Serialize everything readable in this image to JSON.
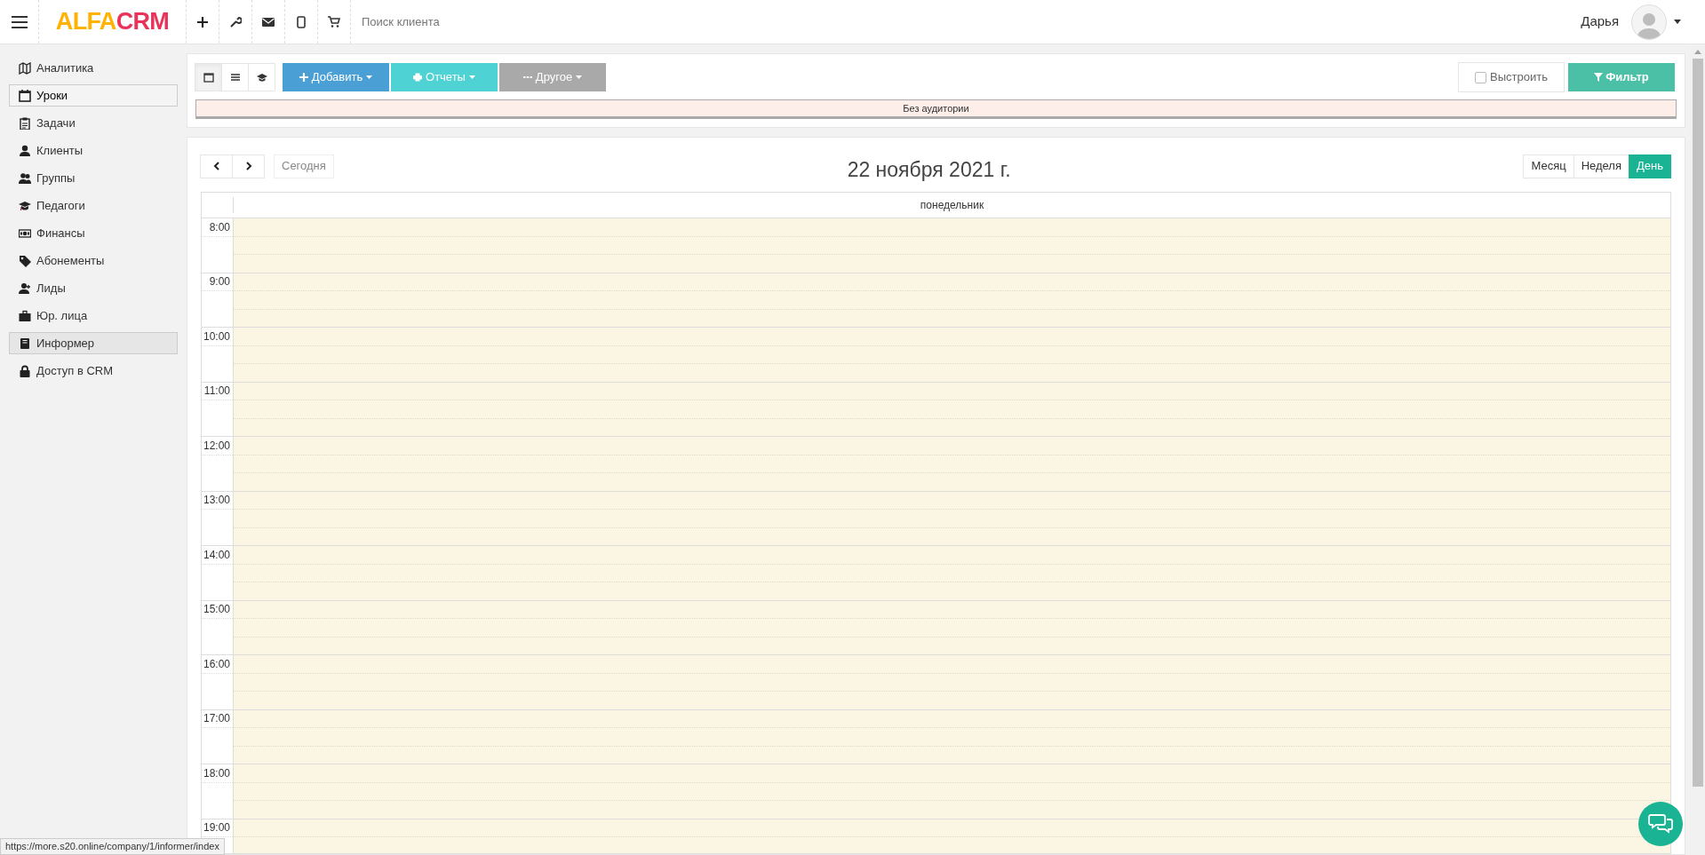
{
  "top_bar": {
    "logo": [
      {
        "text": "ALFA",
        "color": "#ffb300"
      },
      {
        "text": "CRM",
        "color": "#e8335a"
      }
    ],
    "search": {
      "placeholder": "Поиск клиента"
    },
    "user": {
      "name": "Дарья"
    }
  },
  "sidebar": {
    "items": [
      {
        "label": "Аналитика",
        "selected": false,
        "hovered": false
      },
      {
        "label": "Уроки",
        "selected": true,
        "hovered": false
      },
      {
        "label": "Задачи",
        "selected": false,
        "hovered": false
      },
      {
        "label": "Клиенты",
        "selected": false,
        "hovered": false
      },
      {
        "label": "Группы",
        "selected": false,
        "hovered": false
      },
      {
        "label": "Педагоги",
        "selected": false,
        "hovered": false
      },
      {
        "label": "Финансы",
        "selected": false,
        "hovered": false
      },
      {
        "label": "Абонементы",
        "selected": false,
        "hovered": false
      },
      {
        "label": "Лиды",
        "selected": false,
        "hovered": false
      },
      {
        "label": "Юр. лица",
        "selected": false,
        "hovered": false
      },
      {
        "label": "Информер",
        "selected": false,
        "hovered": true
      },
      {
        "label": "Доступ в CRM",
        "selected": false,
        "hovered": false
      }
    ]
  },
  "toolbar": {
    "view_modes": [
      {
        "selected": true
      },
      {
        "selected": false
      },
      {
        "selected": false
      }
    ],
    "buttons": [
      {
        "label": "Добавить"
      },
      {
        "label": "Отчеты"
      },
      {
        "label": "Другое"
      }
    ],
    "arrange": {
      "label": "Выстроить",
      "checked": false
    },
    "filter": {
      "label": "Фильтр"
    },
    "room_bar": "Без аудитории"
  },
  "calendar": {
    "today_button": "Сегодня",
    "title": "22 ноября 2021 г.",
    "views": [
      {
        "label": "Месяц",
        "selected": false
      },
      {
        "label": "Неделя",
        "selected": false
      },
      {
        "label": "День",
        "selected": true
      }
    ],
    "day_header": "понедельник",
    "times": [
      "8:00",
      "9:00",
      "10:00",
      "11:00",
      "12:00",
      "13:00",
      "14:00",
      "15:00",
      "16:00",
      "17:00",
      "18:00",
      "19:00"
    ]
  },
  "status_url": "https://more.s20.online/company/1/informer/index"
}
